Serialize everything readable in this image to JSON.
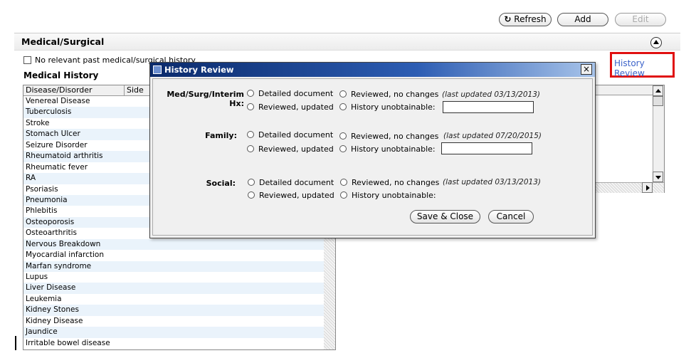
{
  "toolbar": {
    "refresh": "Refresh",
    "add": "Add",
    "edit": "Edit"
  },
  "section": {
    "title": "Medical/Surgical"
  },
  "no_relevant_label": "No relevant past medical/surgical history",
  "medical_history_title": "Medical History",
  "grid": {
    "columns": [
      "Disease/Disorder",
      "Side"
    ],
    "rows": [
      "Venereal Disease",
      "Tuberculosis",
      "Stroke",
      "Stomach Ulcer",
      "Seizure Disorder",
      "Rheumatoid arthritis",
      "Rheumatic fever",
      "RA",
      "Psoriasis",
      "Pneumonia",
      "Phlebitis",
      "Osteoporosis",
      "Osteoarthritis",
      "Nervous Breakdown",
      "Myocardial infarction",
      "Marfan syndrome",
      "Lupus",
      "Liver Disease",
      "Leukemia",
      "Kidney Stones",
      "Kidney Disease",
      "Jaundice",
      "Irritable bowel disease"
    ]
  },
  "history_review_link": "History Review",
  "dialog": {
    "title": "History Review",
    "close": "×",
    "sections": [
      {
        "label": "Med/Surg/Interim Hx:",
        "updated": "(last updated 03/13/2013)"
      },
      {
        "label": "Family:",
        "updated": "(last updated 07/20/2015)"
      },
      {
        "label": "Social:",
        "updated": "(last updated 03/13/2013)"
      }
    ],
    "options": {
      "detailed": "Detailed document",
      "reviewed_no_changes": "Reviewed, no changes",
      "reviewed_updated": "Reviewed, updated",
      "unobtainable": "History unobtainable:"
    },
    "save": "Save & Close",
    "cancel": "Cancel"
  }
}
